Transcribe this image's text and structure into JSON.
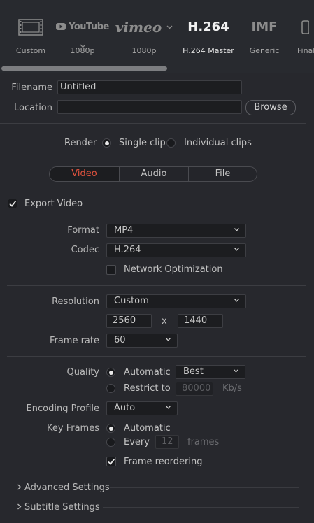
{
  "presets": [
    {
      "id": "custom",
      "logo": "",
      "label": "Custom"
    },
    {
      "id": "youtube",
      "logo": "YouTube",
      "label": "1080p"
    },
    {
      "id": "vimeo",
      "logo": "vimeo",
      "label": "1080p"
    },
    {
      "id": "h264",
      "logo": "H.264",
      "label": "H.264 Master"
    },
    {
      "id": "imf",
      "logo": "IMF",
      "label": "Generic"
    },
    {
      "id": "final",
      "logo": "",
      "label": "Final"
    }
  ],
  "file": {
    "filename_label": "Filename",
    "filename_value": "Untitled",
    "location_label": "Location",
    "location_value": "",
    "browse_label": "Browse"
  },
  "render": {
    "label": "Render",
    "single_clip": "Single clip",
    "individual_clips": "Individual clips"
  },
  "tabs": [
    "Video",
    "Audio",
    "File"
  ],
  "export_video_label": "Export Video",
  "format": {
    "label": "Format",
    "value": "MP4"
  },
  "codec": {
    "label": "Codec",
    "value": "H.264"
  },
  "network_optimization_label": "Network Optimization",
  "resolution": {
    "label": "Resolution",
    "value": "Custom",
    "width": "2560",
    "x": "x",
    "height": "1440"
  },
  "frame_rate": {
    "label": "Frame rate",
    "value": "60"
  },
  "quality": {
    "label": "Quality",
    "automatic": "Automatic",
    "automatic_value": "Best",
    "restrict_to": "Restrict to",
    "restrict_value": "80000",
    "unit": "Kb/s"
  },
  "encoding_profile": {
    "label": "Encoding Profile",
    "value": "Auto"
  },
  "key_frames": {
    "label": "Key Frames",
    "automatic": "Automatic",
    "every": "Every",
    "every_value": "12",
    "frames": "frames"
  },
  "frame_reordering_label": "Frame reordering",
  "advanced_settings": "Advanced Settings",
  "subtitle_settings": "Subtitle Settings",
  "colors": {
    "accent": "#e4533e",
    "panel": "#27282d",
    "field": "#1c1d20"
  }
}
